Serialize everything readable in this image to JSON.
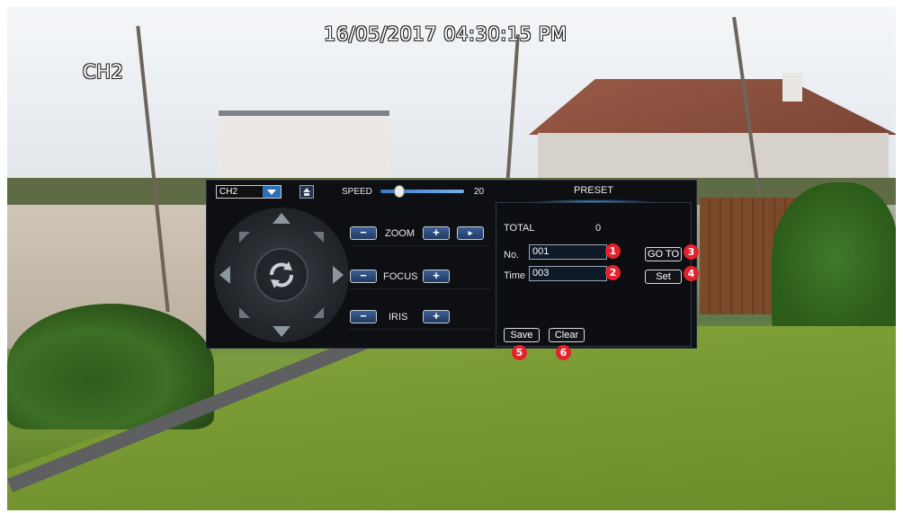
{
  "osd": {
    "datetime": "16/05/2017 04:30:15 PM",
    "channel_label": "CH2"
  },
  "ptz": {
    "channel_select": {
      "selected": "CH2"
    },
    "speed": {
      "label": "SPEED",
      "value": "20"
    },
    "zoom": {
      "label": "ZOOM",
      "minus": "−",
      "plus": "+"
    },
    "focus": {
      "label": "FOCUS",
      "minus": "−",
      "plus": "+"
    },
    "iris": {
      "label": "IRIS",
      "minus": "−",
      "plus": "+"
    }
  },
  "preset": {
    "title": "PRESET",
    "total_label": "TOTAL",
    "total_value": "0",
    "no_label": "No.",
    "no_value": "001",
    "time_label": "Time",
    "time_value": "003",
    "goto_label": "GO TO",
    "set_label": "Set",
    "save_label": "Save",
    "clear_label": "Clear"
  },
  "callouts": [
    "1",
    "2",
    "3",
    "4",
    "5",
    "6"
  ],
  "colors": {
    "panel_bg": "#0d0f12",
    "accent_blue": "#2f6fb8",
    "callout_red": "#e4222c"
  }
}
